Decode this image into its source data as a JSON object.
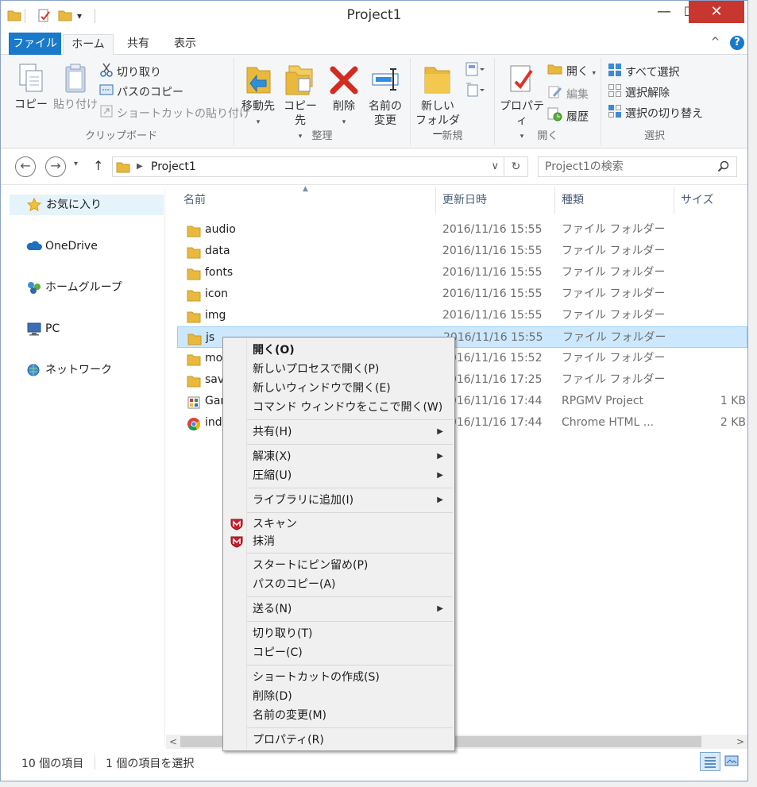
{
  "window": {
    "title": "Project1",
    "minimize_glyph": "—",
    "maximize_glyph": "☐",
    "close_glyph": "✕"
  },
  "tabs": {
    "file": "ファイル",
    "home": "ホーム",
    "share": "共有",
    "view": "表示",
    "collapse_glyph": "^",
    "help_glyph": "?"
  },
  "ribbon": {
    "clipboard": {
      "label": "クリップボード",
      "copy": "コピー",
      "paste": "貼り付け",
      "cut": "切り取り",
      "copy_path": "パスのコピー",
      "paste_shortcut": "ショートカットの貼り付け"
    },
    "organize": {
      "label": "整理",
      "move_to": "移動先",
      "copy_to": "コピー先",
      "delete": "削除",
      "rename_line1": "名前の",
      "rename_line2": "変更"
    },
    "new": {
      "label": "新規",
      "new_folder_line1": "新しい",
      "new_folder_line2": "フォルダー"
    },
    "open": {
      "label": "開く",
      "properties": "プロパティ",
      "open": "開く",
      "edit": "編集",
      "history": "履歴"
    },
    "select": {
      "label": "選択",
      "select_all": "すべて選択",
      "select_none": "選択解除",
      "invert": "選択の切り替え"
    }
  },
  "address": {
    "path": "Project1",
    "search_placeholder": "Project1の検索",
    "back_glyph": "←",
    "forward_glyph": "→",
    "up_glyph": "↑",
    "refresh_glyph": "↻",
    "dropdown_glyph": "∨"
  },
  "nav": {
    "favorites": "お気に入り",
    "onedrive": "OneDrive",
    "homegroup": "ホームグループ",
    "pc": "PC",
    "network": "ネットワーク"
  },
  "columns": {
    "name": "名前",
    "date": "更新日時",
    "type": "種類",
    "size": "サイズ"
  },
  "files": [
    {
      "name": "audio",
      "date": "2016/11/16 15:55",
      "type": "ファイル フォルダー",
      "size": ""
    },
    {
      "name": "data",
      "date": "2016/11/16 15:55",
      "type": "ファイル フォルダー",
      "size": ""
    },
    {
      "name": "fonts",
      "date": "2016/11/16 15:55",
      "type": "ファイル フォルダー",
      "size": ""
    },
    {
      "name": "icon",
      "date": "2016/11/16 15:55",
      "type": "ファイル フォルダー",
      "size": ""
    },
    {
      "name": "img",
      "date": "2016/11/16 15:55",
      "type": "ファイル フォルダー",
      "size": ""
    },
    {
      "name": "js",
      "date": "2016/11/16 15:55",
      "type": "ファイル フォルダー",
      "size": ""
    },
    {
      "name": "mo",
      "date": "2016/11/16 15:52",
      "type": "ファイル フォルダー",
      "size": ""
    },
    {
      "name": "sav",
      "date": "2016/11/16 17:25",
      "type": "ファイル フォルダー",
      "size": ""
    },
    {
      "name": "Gar",
      "date": "2016/11/16 17:44",
      "type": "RPGMV Project",
      "size": "1 KB"
    },
    {
      "name": "ind",
      "date": "2016/11/16 17:44",
      "type": "Chrome HTML ...",
      "size": "2 KB"
    }
  ],
  "status": {
    "item_count": "10 個の項目",
    "selected": "1 個の項目を選択"
  },
  "context_menu": {
    "open": "開く(O)",
    "open_new_process": "新しいプロセスで開く(P)",
    "open_new_window": "新しいウィンドウで開く(E)",
    "open_cmd": "コマンド ウィンドウをここで開く(W)",
    "share": "共有(H)",
    "extract": "解凍(X)",
    "compress": "圧縮(U)",
    "add_library": "ライブラリに追加(I)",
    "scan": "スキャン",
    "shred": "抹消",
    "pin_start": "スタートにピン留め(P)",
    "copy_path": "パスのコピー(A)",
    "send_to": "送る(N)",
    "cut": "切り取り(T)",
    "copy": "コピー(C)",
    "create_shortcut": "ショートカットの作成(S)",
    "delete": "削除(D)",
    "rename": "名前の変更(M)",
    "properties": "プロパティ(R)",
    "submenu_glyph": "▶"
  },
  "colors": {
    "accent": "#1979ca",
    "selection": "#cce8ff",
    "close_button": "#c7372f",
    "folder": "#e8b93c"
  }
}
